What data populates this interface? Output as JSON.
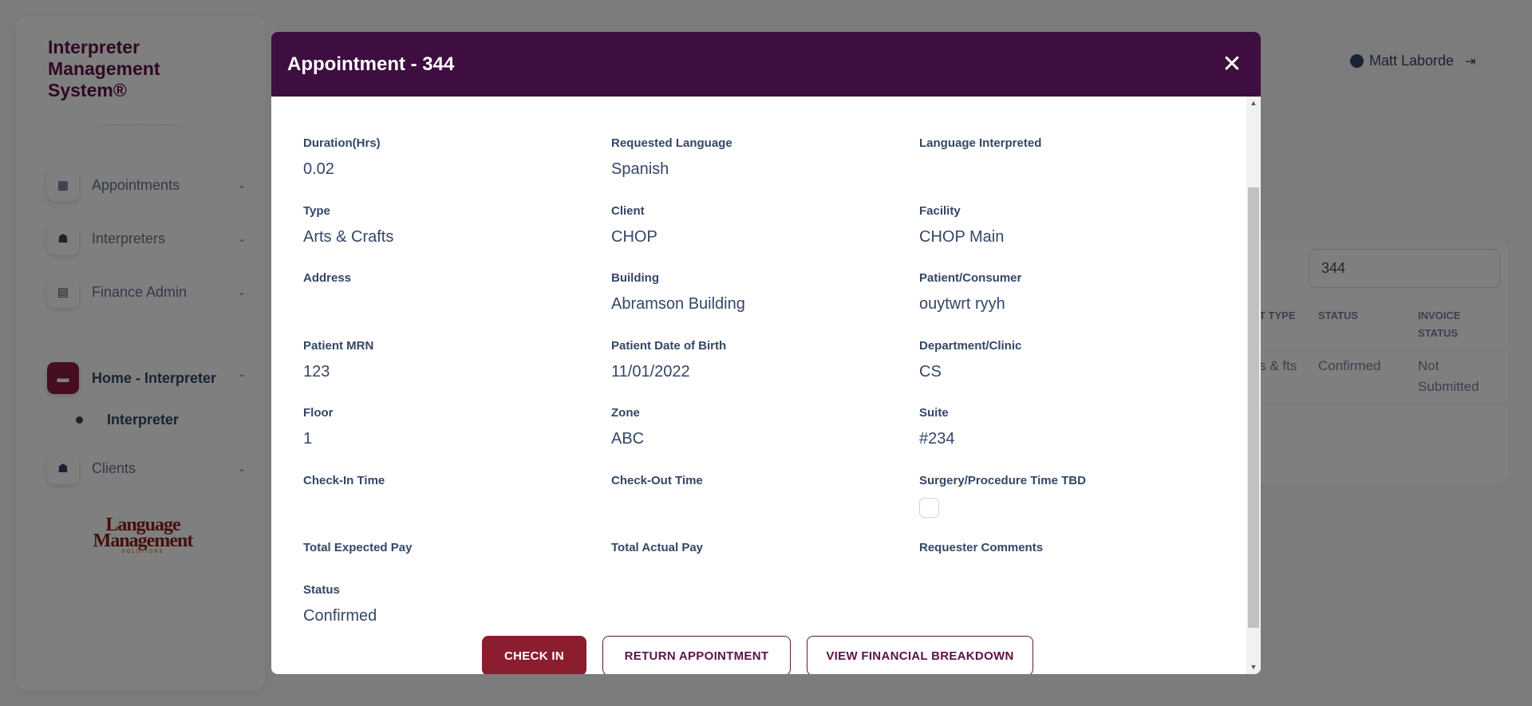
{
  "app": {
    "title": "Interpreter Management System®",
    "logo_text": "Language Management",
    "logo_sub": "SOLUTIONS"
  },
  "sidebar": {
    "items": [
      {
        "label": "Appointments"
      },
      {
        "label": "Interpreters"
      },
      {
        "label": "Finance Admin"
      },
      {
        "label": "Home - Interpreter"
      },
      {
        "label": "Clients"
      }
    ],
    "sub_item": "Interpreter"
  },
  "header": {
    "user_name": "Matt Laborde"
  },
  "background_table": {
    "search_value": "344",
    "headers": [
      "T TYPE",
      "STATUS",
      "INVOICE STATUS"
    ],
    "row": {
      "type": "s & fts",
      "status": "Confirmed",
      "invoice_status": "Not Submitted"
    }
  },
  "modal": {
    "title": "Appointment - 344",
    "fields": {
      "duration": {
        "label": "Duration(Hrs)",
        "value": "0.02"
      },
      "requested_language": {
        "label": "Requested Language",
        "value": "Spanish"
      },
      "language_interpreted": {
        "label": "Language Interpreted",
        "value": ""
      },
      "type": {
        "label": "Type",
        "value": "Arts & Crafts"
      },
      "client": {
        "label": "Client",
        "value": "CHOP"
      },
      "facility": {
        "label": "Facility",
        "value": "CHOP Main"
      },
      "address": {
        "label": "Address",
        "value": ""
      },
      "building": {
        "label": "Building",
        "value": "Abramson Building"
      },
      "patient": {
        "label": "Patient/Consumer",
        "value": "ouytwrt ryyh"
      },
      "patient_mrn": {
        "label": "Patient MRN",
        "value": "123"
      },
      "patient_dob": {
        "label": "Patient Date of Birth",
        "value": "11/01/2022"
      },
      "department": {
        "label": "Department/Clinic",
        "value": "CS"
      },
      "floor": {
        "label": "Floor",
        "value": "1"
      },
      "zone": {
        "label": "Zone",
        "value": "ABC"
      },
      "suite": {
        "label": "Suite",
        "value": "#234"
      },
      "check_in": {
        "label": "Check-In Time",
        "value": ""
      },
      "check_out": {
        "label": "Check-Out Time",
        "value": ""
      },
      "surgery_tbd": {
        "label": "Surgery/Procedure Time TBD",
        "checked": false
      },
      "total_expected": {
        "label": "Total Expected Pay",
        "value": ""
      },
      "total_actual": {
        "label": "Total Actual Pay",
        "value": ""
      },
      "requester_comments": {
        "label": "Requester Comments",
        "value": ""
      },
      "status": {
        "label": "Status",
        "value": "Confirmed"
      }
    },
    "buttons": {
      "check_in": "CHECK IN",
      "return": "RETURN APPOINTMENT",
      "financial": "VIEW FINANCIAL BREAKDOWN"
    }
  }
}
